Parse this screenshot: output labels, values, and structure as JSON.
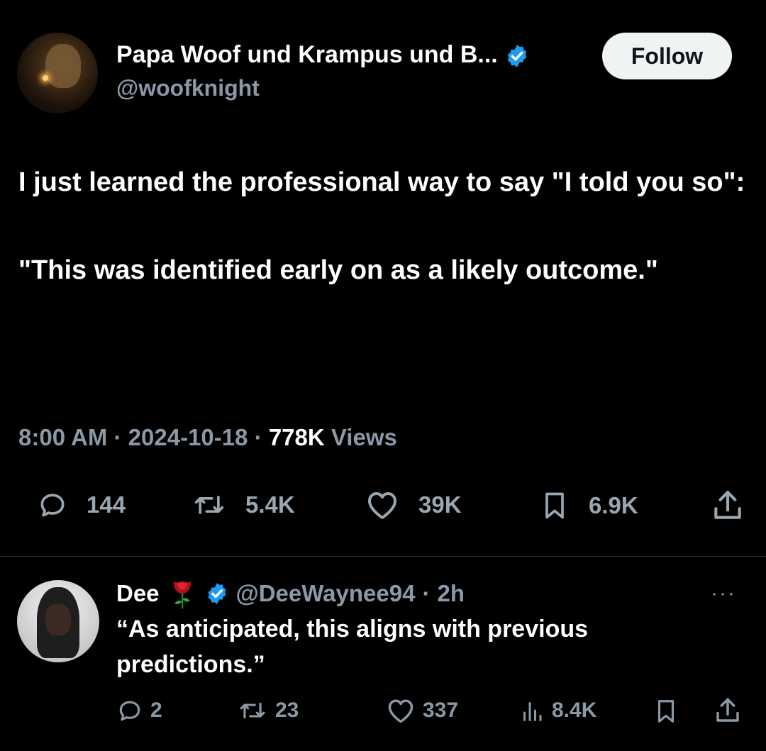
{
  "main_tweet": {
    "display_name": "Papa Woof und Krampus und B...",
    "handle": "@woofknight",
    "follow_label": "Follow",
    "text_line1": "I just learned the professional way to say \"I told you so\":",
    "text_line2": "\"This was identified early on as a likely outcome.\"",
    "time": "8:00 AM",
    "date": "2024-10-18",
    "views_count": "778K",
    "views_label": "Views",
    "separator": "·",
    "replies": "144",
    "reposts": "5.4K",
    "likes": "39K",
    "bookmarks": "6.9K"
  },
  "reply": {
    "display_name": "Dee",
    "handle": "@DeeWaynee94",
    "separator": "·",
    "age": "2h",
    "more": "···",
    "text": "“As anticipated, this aligns with previous predictions.”",
    "replies": "2",
    "reposts": "23",
    "likes": "337",
    "views": "8.4K"
  },
  "icons": {
    "verified": "verified-badge-icon",
    "rose": "rose-emoji",
    "reply": "reply-icon",
    "repost": "repost-icon",
    "like": "heart-icon",
    "bookmark": "bookmark-icon",
    "share": "share-icon",
    "views": "views-icon"
  },
  "colors": {
    "background": "#000000",
    "text": "#ffffff",
    "muted": "#8b98a5",
    "verified": "#1d9bf0",
    "follow_bg": "#eff3f4"
  }
}
